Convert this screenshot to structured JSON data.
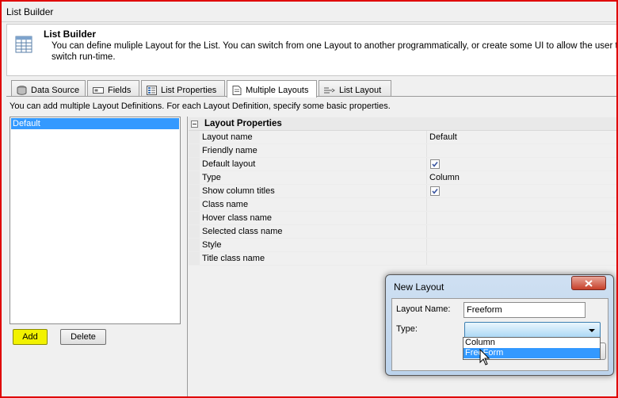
{
  "window": {
    "title": "List Builder"
  },
  "header": {
    "title": "List Builder",
    "description": "You can define muliple Layout for the List. You can switch from one Layout to another programmatically, or create some UI to allow the user to switch run-time."
  },
  "tabs": [
    {
      "label": "Data Source",
      "icon": "database-icon"
    },
    {
      "label": "Fields",
      "icon": "fields-icon"
    },
    {
      "label": "List Properties",
      "icon": "properties-icon"
    },
    {
      "label": "Multiple Layouts",
      "icon": "layouts-icon",
      "active": true
    },
    {
      "label": "List Layout",
      "icon": "list-layout-icon"
    }
  ],
  "hint": "You can add multiple Layout Definitions. For each Layout Definition, specify some basic properties.",
  "layouts": {
    "items": [
      "Default"
    ],
    "selected": "Default",
    "add_label": "Add",
    "delete_label": "Delete"
  },
  "properties": {
    "category": "Layout Properties",
    "rows": [
      {
        "name": "Layout name",
        "value": "Default"
      },
      {
        "name": "Friendly name",
        "value": ""
      },
      {
        "name": "Default layout",
        "checkbox": true,
        "checked": true
      },
      {
        "name": "Type",
        "value": "Column"
      },
      {
        "name": "Show column titles",
        "checkbox": true,
        "checked": true
      },
      {
        "name": "Class name",
        "value": ""
      },
      {
        "name": "Hover class name",
        "value": ""
      },
      {
        "name": "Selected class name",
        "value": ""
      },
      {
        "name": "Style",
        "value": ""
      },
      {
        "name": "Title class name",
        "value": ""
      }
    ]
  },
  "dialog": {
    "title": "New Layout",
    "layout_name_label": "Layout Name:",
    "layout_name_value": "Freeform",
    "type_label": "Type:",
    "type_value": "",
    "options": [
      "Column",
      "FreeForm"
    ],
    "highlighted_option": "FreeForm"
  },
  "colors": {
    "border_highlight": "#e00000",
    "selection": "#3399ff",
    "add_highlight": "#f2f200"
  }
}
